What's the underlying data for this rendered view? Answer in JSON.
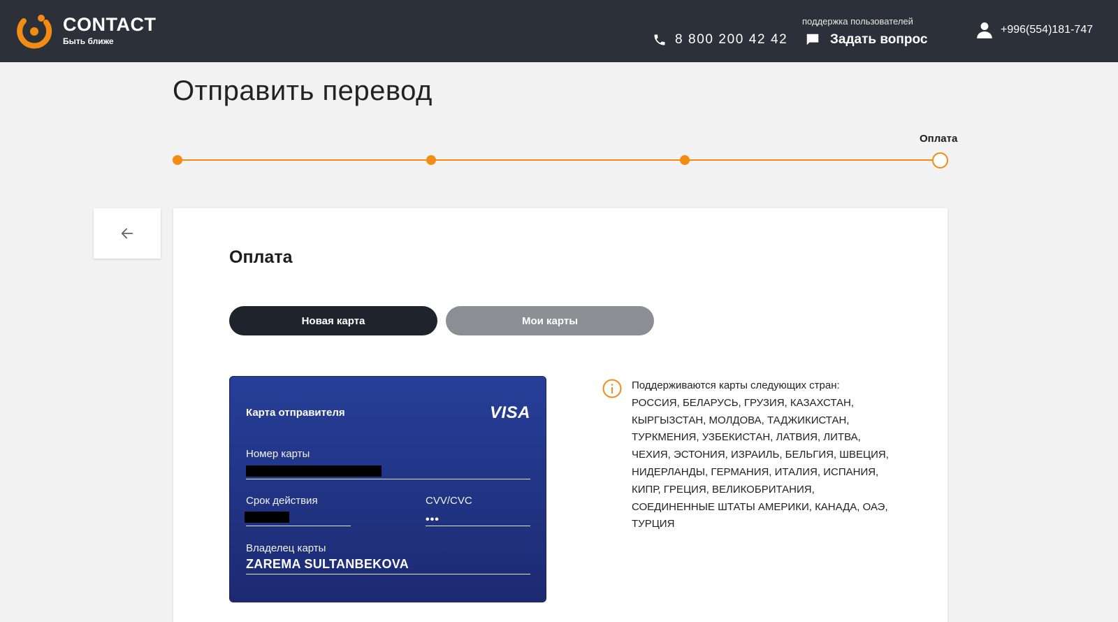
{
  "header": {
    "brand_name": "CONTACT",
    "brand_tagline": "Быть ближе",
    "phone": "8 800 200 42 42",
    "support_label": "поддержка пользователей",
    "ask_label": "Задать вопрос",
    "user_phone": "+996(554)181-747"
  },
  "page": {
    "title": "Отправить перевод"
  },
  "stepper": {
    "current_label": "Оплата",
    "current_step": 4,
    "total_steps": 4
  },
  "payment": {
    "title": "Оплата",
    "tabs": [
      {
        "label": "Новая карта",
        "active": true
      },
      {
        "label": "Мои карты",
        "active": false
      }
    ],
    "card": {
      "title": "Карта отправителя",
      "brand": "VISA",
      "number_label": "Номер карты",
      "expiry_label": "Срок действия",
      "cvv_label": "CVV/CVC",
      "cvv_value": "•••",
      "holder_label": "Владелец карты",
      "holder_value": "ZAREMA SULTANBEKOVA"
    },
    "info": {
      "intro": "Поддерживаются карты следующих стран:",
      "countries": "РОССИЯ, БЕЛАРУСЬ, ГРУЗИЯ, КАЗАХСТАН, КЫРГЫЗСТАН, МОЛДОВА, ТАДЖИКИСТАН, ТУРКМЕНИЯ, УЗБЕКИСТАН, ЛАТВИЯ, ЛИТВА, ЧЕХИЯ, ЭСТОНИЯ, ИЗРАИЛЬ, БЕЛЬГИЯ, ШВЕЦИЯ, НИДЕРЛАНДЫ, ГЕРМАНИЯ, ИТАЛИЯ, ИСПАНИЯ, КИПР, ГРЕЦИЯ, ВЕЛИКОБРИТАНИЯ, СОЕДИНЕННЫЕ ШТАТЫ АМЕРИКИ, КАНАДА, ОАЭ, ТУРЦИЯ"
    }
  },
  "colors": {
    "header_bg": "#2c3039",
    "accent": "#f28c12",
    "card_top": "#263f98",
    "card_bottom": "#1d2a72",
    "tab_active": "#1f232c",
    "tab_inactive": "#8c8e94"
  },
  "icons": {
    "logo": "contact-logo-icon",
    "phone": "phone-icon",
    "chat": "chat-icon",
    "user": "user-icon",
    "back": "arrow-left-icon",
    "info": "info-icon"
  }
}
